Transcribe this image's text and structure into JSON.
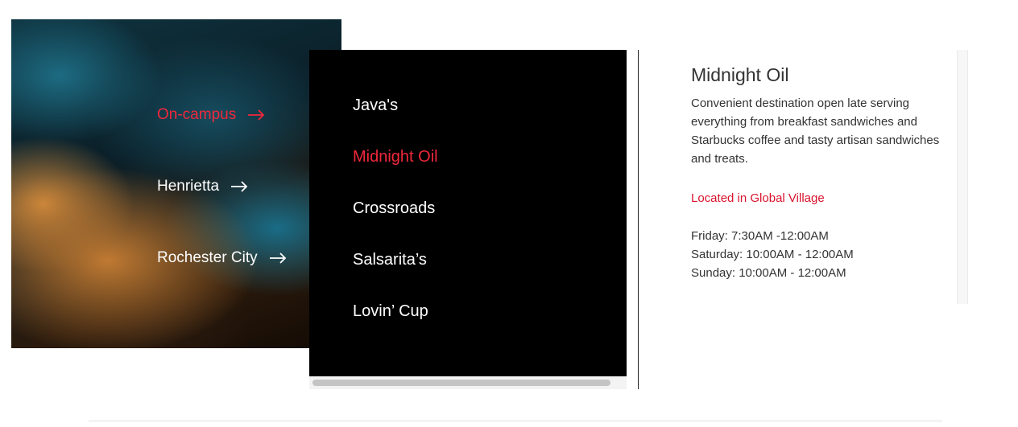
{
  "regions": [
    {
      "label": "On-campus",
      "active": true
    },
    {
      "label": "Henrietta",
      "active": false
    },
    {
      "label": "Rochester City",
      "active": false
    }
  ],
  "venues": [
    {
      "label": "Java's",
      "active": false
    },
    {
      "label": "Midnight Oil",
      "active": true
    },
    {
      "label": "Crossroads",
      "active": false
    },
    {
      "label": "Salsarita’s",
      "active": false
    },
    {
      "label": "Lovin’ Cup",
      "active": false
    }
  ],
  "detail": {
    "title": "Midnight Oil",
    "description": "Convenient destination open late serving everything from breakfast sandwiches and Starbucks coffee and tasty artisan sandwiches and treats.",
    "location": "Located in Global Village",
    "hours": [
      "Friday: 7:30AM -12:00AM",
      "Saturday: 10:00AM - 12:00AM",
      "Sunday: 10:00AM - 12:00AM"
    ]
  },
  "colors": {
    "accent": "#f0283c",
    "link": "#d8132d"
  },
  "icons": {
    "region_arrow": "arrow-right-icon"
  }
}
